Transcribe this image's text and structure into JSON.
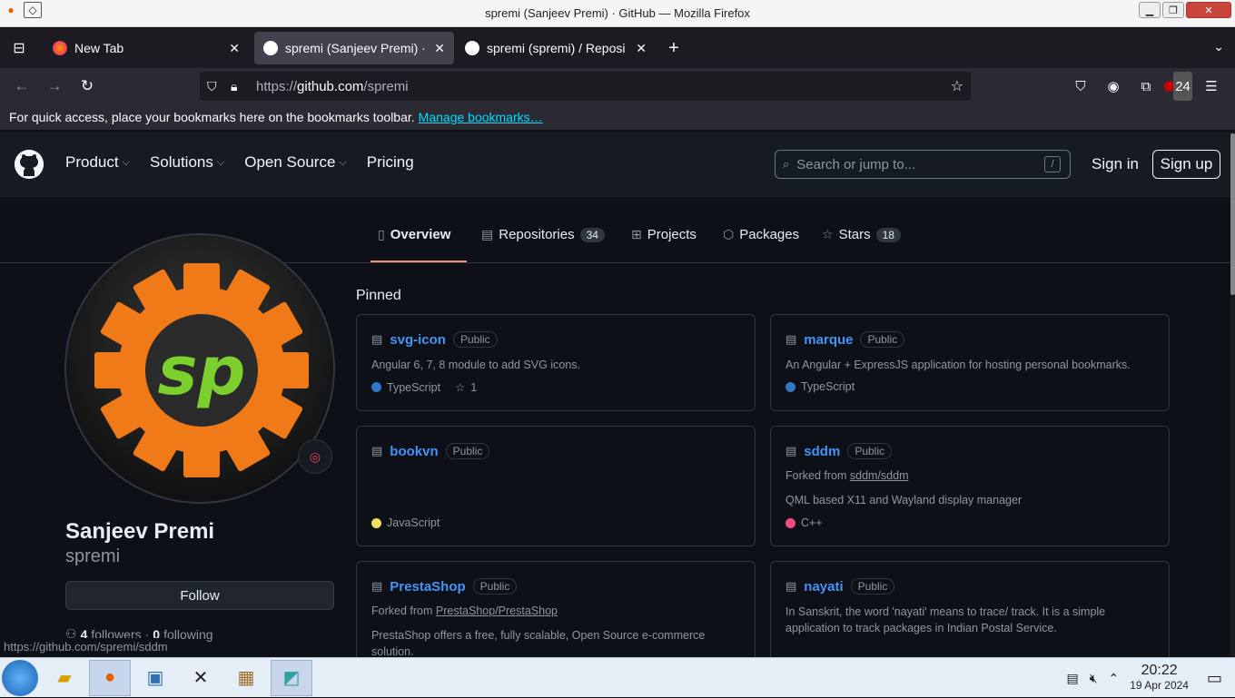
{
  "window": {
    "title": "spremi (Sanjeev Premi) · GitHub — Mozilla Firefox"
  },
  "tabs": [
    {
      "label": "New Tab",
      "active": false
    },
    {
      "label": "spremi (Sanjeev Premi) · ",
      "active": true
    },
    {
      "label": "spremi (spremi) / Reposi",
      "active": false
    }
  ],
  "url": {
    "prefix": "https://",
    "host": "github.com",
    "path": "/spremi"
  },
  "toolbar": {
    "extensions_badge": "24"
  },
  "bookmarks_bar": {
    "text": "For quick access, place your bookmarks here on the bookmarks toolbar.",
    "link": "Manage bookmarks…"
  },
  "gh_header": {
    "nav": [
      "Product",
      "Solutions",
      "Open Source",
      "Pricing"
    ],
    "search_placeholder": "Search or jump to...",
    "search_key": "/",
    "signin": "Sign in",
    "signup": "Sign up"
  },
  "profile_tabs": [
    {
      "label": "Overview",
      "count": ""
    },
    {
      "label": "Repositories",
      "count": "34"
    },
    {
      "label": "Projects",
      "count": ""
    },
    {
      "label": "Packages",
      "count": ""
    },
    {
      "label": "Stars",
      "count": "18"
    }
  ],
  "profile": {
    "avatar_text": "sp",
    "name": "Sanjeev Premi",
    "login": "spremi",
    "follow": "Follow",
    "followers_count": "4",
    "followers_label": "followers",
    "following_count": "0",
    "following_label": "following"
  },
  "pinned": {
    "heading": "Pinned",
    "repos": [
      {
        "name": "svg-icon",
        "visibility": "Public",
        "desc": "Angular 6, 7, 8 module to add SVG icons.",
        "fork": "",
        "lang": "TypeScript",
        "lang_color": "#3178c6",
        "stars": "1"
      },
      {
        "name": "marque",
        "visibility": "Public",
        "desc": "An Angular + ExpressJS application for hosting personal bookmarks.",
        "fork": "",
        "lang": "TypeScript",
        "lang_color": "#3178c6",
        "stars": ""
      },
      {
        "name": "bookvn",
        "visibility": "Public",
        "desc": "",
        "fork": "",
        "lang": "JavaScript",
        "lang_color": "#f1e05a",
        "stars": ""
      },
      {
        "name": "sddm",
        "visibility": "Public",
        "desc": "QML based X11 and Wayland display manager",
        "fork_prefix": "Forked from",
        "fork": "sddm/sddm",
        "lang": "C++",
        "lang_color": "#f34b7d",
        "stars": ""
      },
      {
        "name": "PrestaShop",
        "visibility": "Public",
        "desc": "PrestaShop offers a free, fully scalable, Open Source e-commerce solution.",
        "fork_prefix": "Forked from",
        "fork": "PrestaShop/PrestaShop",
        "lang": "",
        "stars": ""
      },
      {
        "name": "nayati",
        "visibility": "Public",
        "desc": "In Sanskrit, the word 'nayati' means to trace/ track. It is a simple application to track packages in Indian Postal Service.",
        "fork": "",
        "lang": "",
        "stars": ""
      }
    ]
  },
  "status_url": "https://github.com/spremi/sddm",
  "clock": {
    "time": "20:22",
    "date": "19 Apr 2024"
  }
}
